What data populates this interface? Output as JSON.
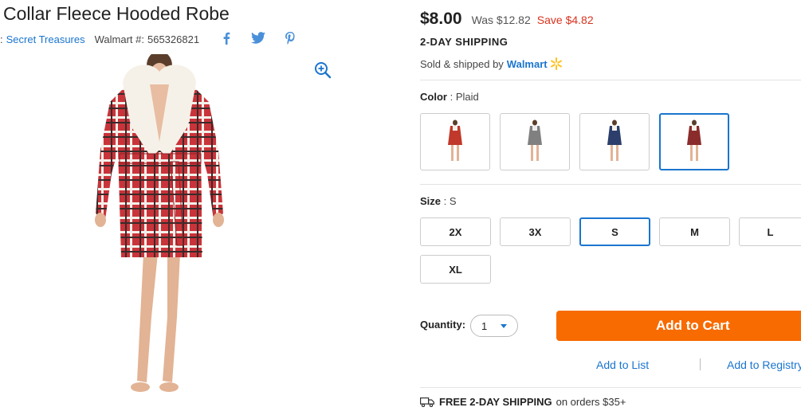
{
  "product": {
    "title": "Collar Fleece Hooded Robe",
    "brand_prefix": ":",
    "brand": "Secret Treasures",
    "walmart_number_label": "Walmart #:",
    "walmart_number": "565326821",
    "social_icons": [
      "facebook-icon",
      "twitter-icon",
      "pinterest-icon"
    ]
  },
  "pricing": {
    "price": "$8.00",
    "was": "Was $12.82",
    "save": "Save $4.82",
    "shipping": "2-DAY SHIPPING",
    "sold_by": "Sold & shipped by",
    "seller": "Walmart"
  },
  "color": {
    "label": "Color",
    "separator": ":",
    "selected": "Plaid",
    "swatches": [
      {
        "name": "red-plaid",
        "color": "#c0392b"
      },
      {
        "name": "gray",
        "color": "#808080"
      },
      {
        "name": "navy-plaid",
        "color": "#2c3e6b"
      },
      {
        "name": "plaid",
        "color": "#8b2c2c"
      }
    ]
  },
  "size": {
    "label": "Size",
    "separator": ":",
    "selected": "S",
    "options": [
      "2X",
      "3X",
      "S",
      "M",
      "L",
      "XL"
    ]
  },
  "purchase": {
    "quantity_label": "Quantity:",
    "quantity": "1",
    "add_to_cart": "Add to Cart",
    "add_to_list": "Add to List",
    "add_to_registry": "Add to Registry"
  },
  "footer": {
    "free_shipping": "FREE 2-DAY SHIPPING",
    "free_shipping_rest": "on orders $35+"
  },
  "colors": {
    "link_blue": "#1a75cf",
    "cta_orange": "#f76b00",
    "save_red": "#d9331f",
    "spark_yellow": "#ffc220"
  }
}
